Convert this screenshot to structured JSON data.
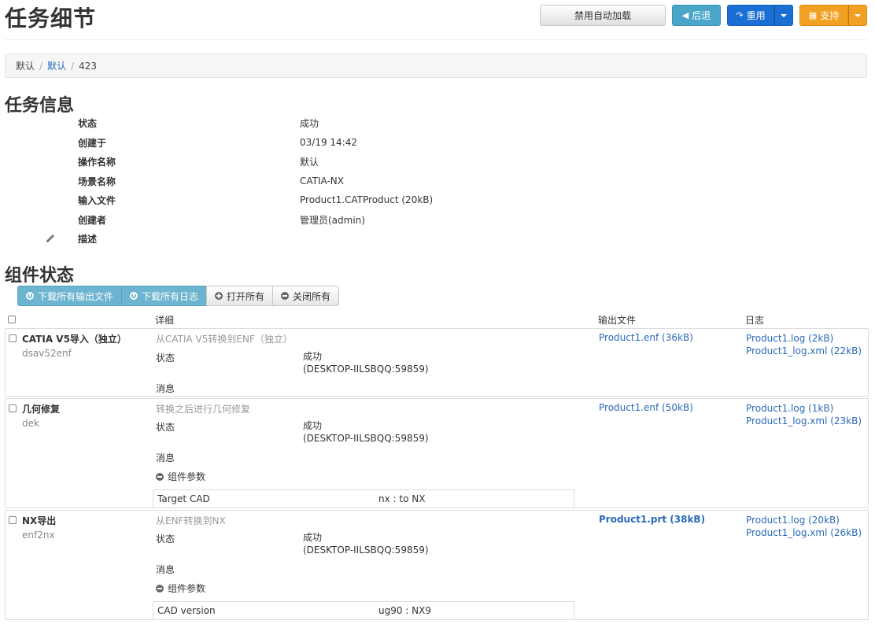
{
  "page_title": "任务细节",
  "top_buttons": {
    "disable_autoload": "禁用自动加载",
    "back": "后退",
    "reuse": "重用",
    "support": "支持"
  },
  "breadcrumb": {
    "items": [
      "默认",
      "默认",
      "423"
    ]
  },
  "task_info": {
    "title": "任务信息",
    "rows": [
      {
        "label": "状态",
        "value": "成功",
        "link": false
      },
      {
        "label": "创建于",
        "value": "03/19 14:42",
        "link": false
      },
      {
        "label": "操作名称",
        "value": "默认",
        "link": true
      },
      {
        "label": "场景名称",
        "value": "CATIA-NX",
        "link": false
      },
      {
        "label": "输入文件",
        "value": "Product1.CATProduct (20kB)",
        "link": true
      },
      {
        "label": "创建者",
        "value": "管理员(admin)",
        "link": false
      },
      {
        "label": "描述",
        "value": "",
        "link": false
      }
    ]
  },
  "components": {
    "title": "组件状态",
    "toolbar": {
      "download_outputs": "下载所有输出文件",
      "download_logs": "下载所有日志",
      "open_all": "打开所有",
      "close_all": "关闭所有"
    },
    "headers": {
      "detail": "详细",
      "output": "输出文件",
      "log": "日志"
    },
    "items": [
      {
        "name": "CATIA V5导入（独立）",
        "id": "dsav52enf",
        "description": "从CATIA V5转换到ENF（独立）",
        "status_label": "状态",
        "status_value": "成功",
        "status_host": "(DESKTOP-IILSBQQ:59859)",
        "message_label": "消息",
        "output": "Product1.enf (36kB)",
        "logs": [
          "Product1.log (2kB)",
          "Product1_log.xml (22kB)"
        ]
      },
      {
        "name": "几何修复",
        "id": "dek",
        "description": "转换之后进行几何修复",
        "status_label": "状态",
        "status_value": "成功",
        "status_host": "(DESKTOP-IILSBQQ:59859)",
        "message_label": "消息",
        "params_label": "组件参数",
        "param_key": "Target CAD",
        "param_value": "nx : to NX",
        "output": "Product1.enf (50kB)",
        "logs": [
          "Product1.log (1kB)",
          "Product1_log.xml (23kB)"
        ]
      },
      {
        "name": "NX导出",
        "id": "enf2nx",
        "description": "从ENF转换到NX",
        "status_label": "状态",
        "status_value": "成功",
        "status_host": "(DESKTOP-IILSBQQ:59859)",
        "message_label": "消息",
        "params_label": "组件参数",
        "param_key": "CAD version",
        "param_value": "ug90 : NX9",
        "output": "Product1.prt (38kB)",
        "logs": [
          "Product1.log (20kB)",
          "Product1_log.xml (26kB)"
        ]
      }
    ]
  },
  "colors": {
    "link": "#2a6ab8",
    "info_button": "#4aa6c8",
    "primary_button": "#1b6fd4",
    "warning_button": "#f2a024"
  }
}
